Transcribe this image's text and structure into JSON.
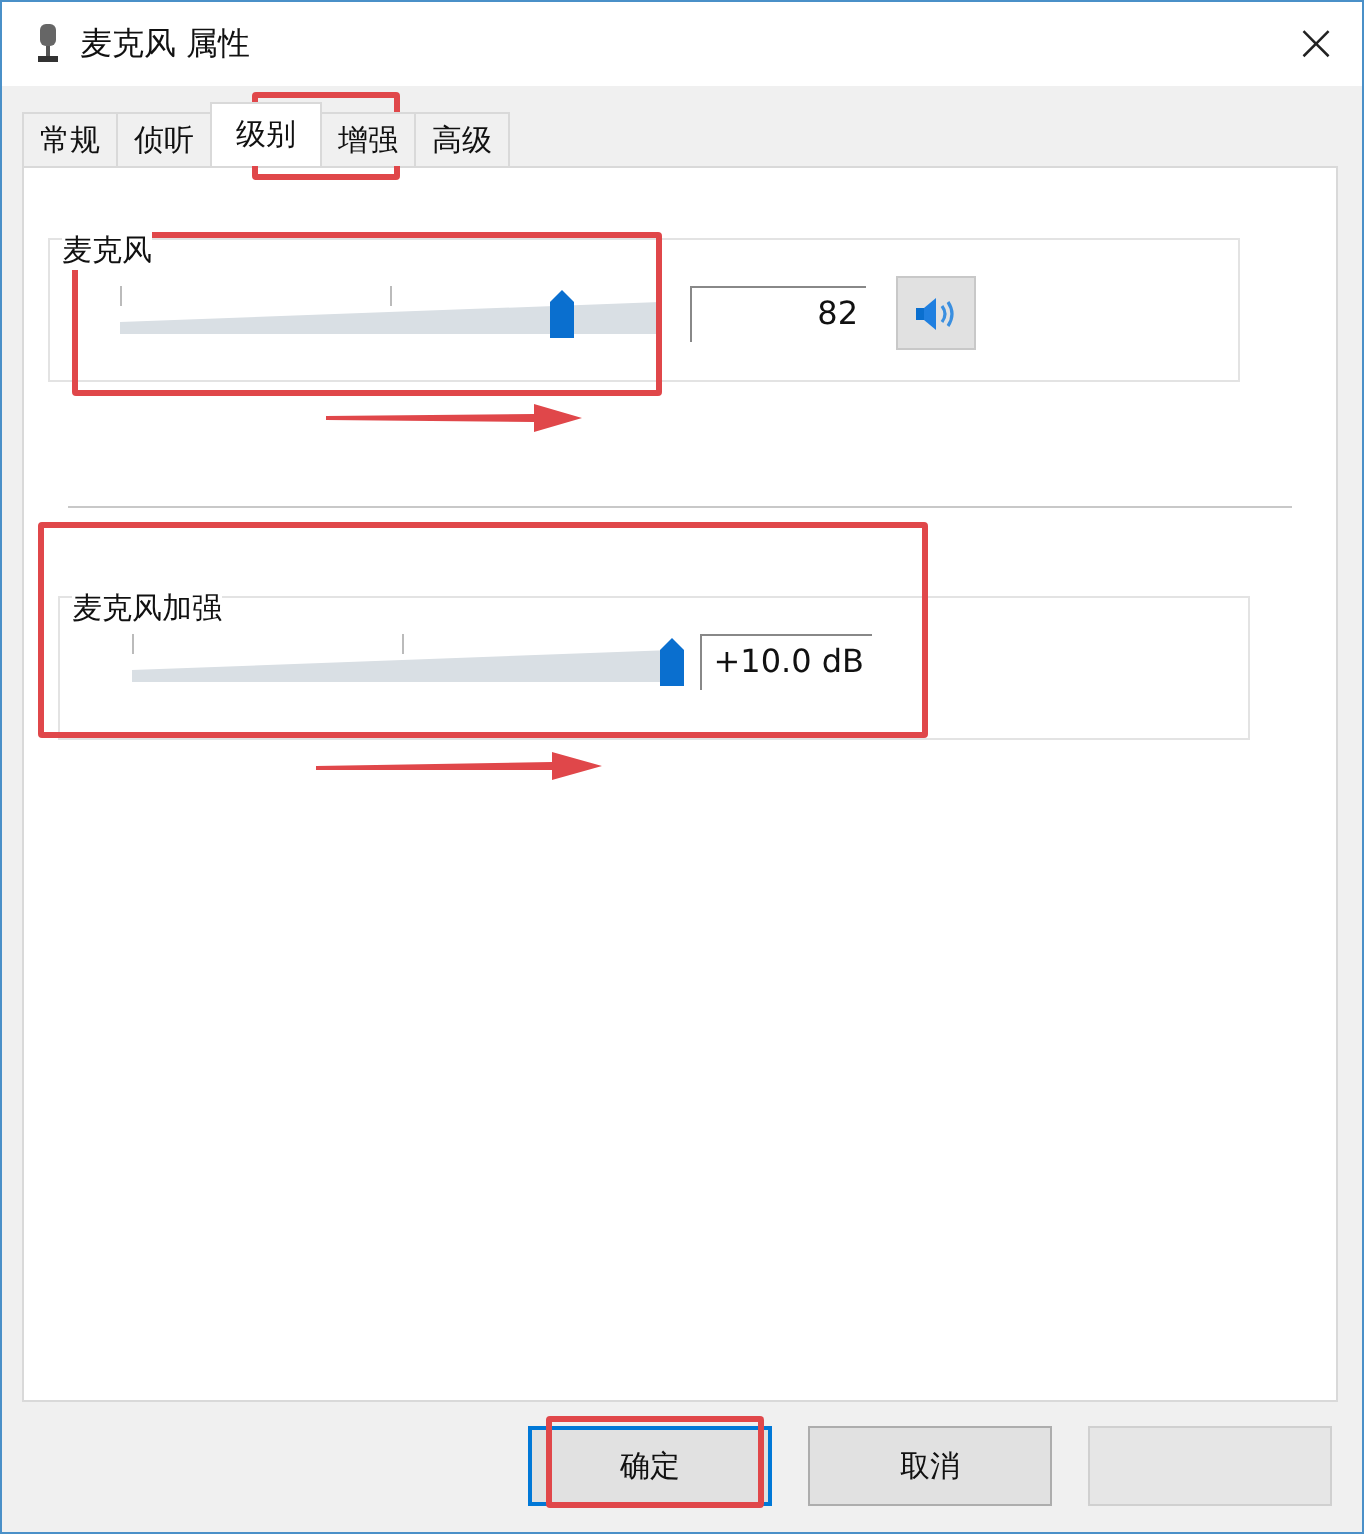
{
  "window": {
    "title": "麦克风 属性",
    "close": "×"
  },
  "tabs": [
    {
      "label": "常规",
      "selected": false
    },
    {
      "label": "侦听",
      "selected": false
    },
    {
      "label": "级别",
      "selected": true
    },
    {
      "label": "增强",
      "selected": false
    },
    {
      "label": "高级",
      "selected": false
    }
  ],
  "levels": [
    {
      "name": "麦克风",
      "level": 0.82,
      "reading": "82",
      "mute_button": true
    },
    {
      "name": "麦克风加强",
      "level": 1,
      "reading": "+10.0 dB",
      "mute_button": false
    }
  ],
  "buttons": [
    {
      "label": "确定",
      "kind": "default",
      "disabled": false
    },
    {
      "label": "取消",
      "kind": "normal",
      "disabled": false
    },
    {
      "kind": "normal",
      "disabled": true
    }
  ]
}
